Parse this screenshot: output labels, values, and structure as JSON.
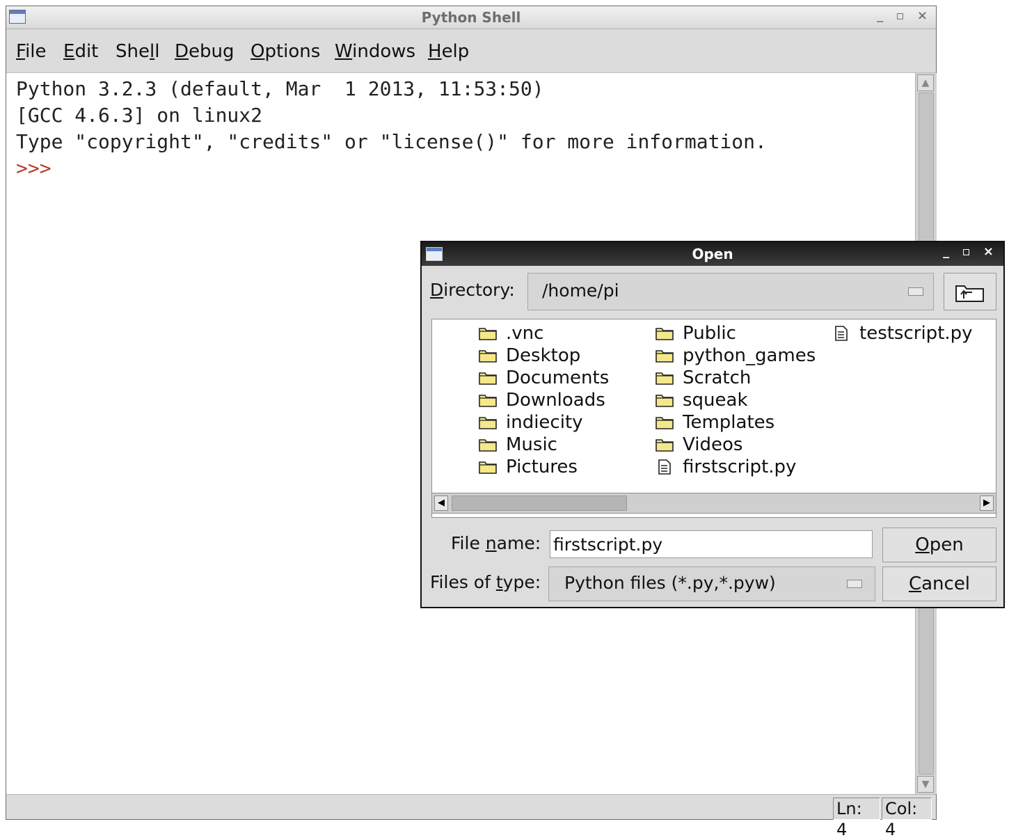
{
  "shell": {
    "title": "Python Shell",
    "window_buttons": "_ ▫ ×",
    "menu": [
      {
        "label": "File",
        "accel": "F",
        "rest": "ile"
      },
      {
        "label": "Edit",
        "accel": "E",
        "rest": "dit"
      },
      {
        "label": "Shell",
        "pre": "She",
        "accel": "l",
        "rest": "l"
      },
      {
        "label": "Debug",
        "accel": "D",
        "rest": "ebug"
      },
      {
        "label": "Options",
        "accel": "O",
        "rest": "ptions"
      },
      {
        "label": "Windows",
        "accel": "W",
        "rest": "indows"
      },
      {
        "label": "Help",
        "accel": "H",
        "rest": "elp"
      }
    ],
    "lines": [
      "Python 3.2.3 (default, Mar  1 2013, 11:53:50)",
      "[GCC 4.6.3] on linux2",
      "Type \"copyright\", \"credits\" or \"license()\" for more information."
    ],
    "prompt": ">>>",
    "status": {
      "ln": "Ln: 4",
      "col": "Col: 4"
    }
  },
  "dialog": {
    "title": "Open",
    "window_buttons": "_ ▫ ×",
    "directory_label": {
      "accel": "D",
      "rest": "irectory:"
    },
    "directory_value": "/home/pi",
    "files": [
      [
        {
          "name": ".vnc",
          "icon": "folder-icon"
        },
        {
          "name": "Desktop",
          "icon": "folder-icon"
        },
        {
          "name": "Documents",
          "icon": "folder-icon"
        },
        {
          "name": "Downloads",
          "icon": "folder-icon"
        },
        {
          "name": "indiecity",
          "icon": "folder-icon"
        },
        {
          "name": "Music",
          "icon": "folder-icon"
        },
        {
          "name": "Pictures",
          "icon": "folder-icon"
        }
      ],
      [
        {
          "name": "Public",
          "icon": "folder-icon"
        },
        {
          "name": "python_games",
          "icon": "folder-icon"
        },
        {
          "name": "Scratch",
          "icon": "folder-icon"
        },
        {
          "name": "squeak",
          "icon": "folder-icon"
        },
        {
          "name": "Templates",
          "icon": "folder-icon"
        },
        {
          "name": "Videos",
          "icon": "folder-icon"
        },
        {
          "name": "firstscript.py",
          "icon": "file-icon"
        }
      ],
      [
        {
          "name": "testscript.py",
          "icon": "file-icon"
        }
      ]
    ],
    "filename_label": {
      "pre": "File ",
      "accel": "n",
      "rest": "ame:"
    },
    "filename_value": "firstscript.py",
    "filetype_label": {
      "pre": "Files of ",
      "accel": "t",
      "rest": "ype:"
    },
    "filetype_value": "Python files (*.py,*.pyw)",
    "open_button": {
      "accel": "O",
      "rest": "pen"
    },
    "cancel_button": {
      "accel": "C",
      "rest": "ancel"
    }
  },
  "colors": {
    "prompt": "#c0392b",
    "folder_fill": "#f5e88a",
    "dialog_titlebar": "#222222"
  }
}
